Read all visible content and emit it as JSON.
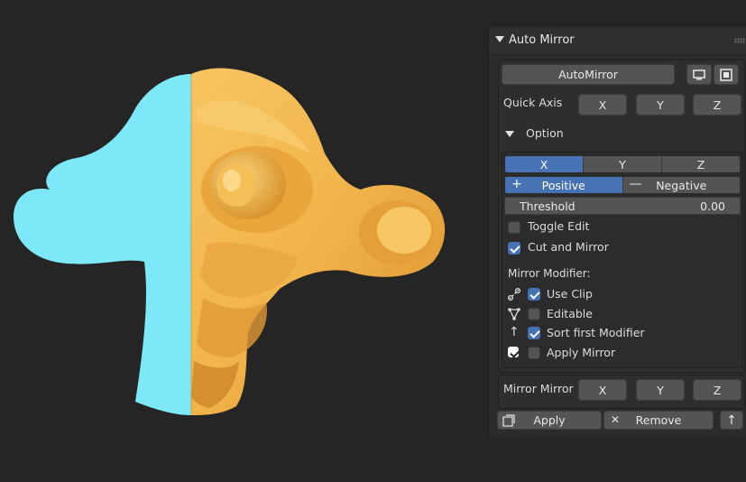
{
  "panel": {
    "title": "Auto Mirror",
    "automirror_button": "AutoMirror",
    "quick_axis": {
      "label": "Quick Axis",
      "x": "X",
      "y": "Y",
      "z": "Z"
    },
    "option_label": "Option",
    "axis_seg": {
      "x": "X",
      "y": "Y",
      "z": "Z",
      "selected": "X"
    },
    "direction": {
      "positive": "Positive",
      "negative": "Negative",
      "positive_icon": "+",
      "negative_icon": "—",
      "selected": "Positive"
    },
    "threshold": {
      "label": "Threshold",
      "value": "0.00"
    },
    "toggle_edit": {
      "label": "Toggle Edit",
      "checked": false
    },
    "cut_and_mirror": {
      "label": "Cut and Mirror",
      "checked": true
    },
    "mirror_modifier_label": "Mirror Modifier:",
    "use_clip": {
      "label": "Use Clip",
      "checked": true
    },
    "editable": {
      "label": "Editable",
      "checked": false
    },
    "sort_first": {
      "label": "Sort first Modifier",
      "checked": true
    },
    "apply_mirror": {
      "label": "Apply Mirror",
      "checked": false
    },
    "mirror_mirror": {
      "label": "Mirror Mirror",
      "x": "X",
      "y": "Y",
      "z": "Z"
    },
    "apply_button": "Apply",
    "remove_button": "Remove",
    "remove_icon": "✕",
    "up_icon": "↑"
  },
  "colors": {
    "accent": "#4772b3",
    "mirror_half": "#7de8f7",
    "mesh": "#f1b44a",
    "background": "#252525"
  },
  "icons": [
    "panel-collapse-arrow-icon",
    "grip-icon",
    "monitor-icon",
    "square-icon",
    "option-triangle-icon",
    "clip-icon",
    "vertex-icon",
    "arrow-up-icon",
    "checkbox-icon",
    "apply-icon",
    "close-icon"
  ]
}
